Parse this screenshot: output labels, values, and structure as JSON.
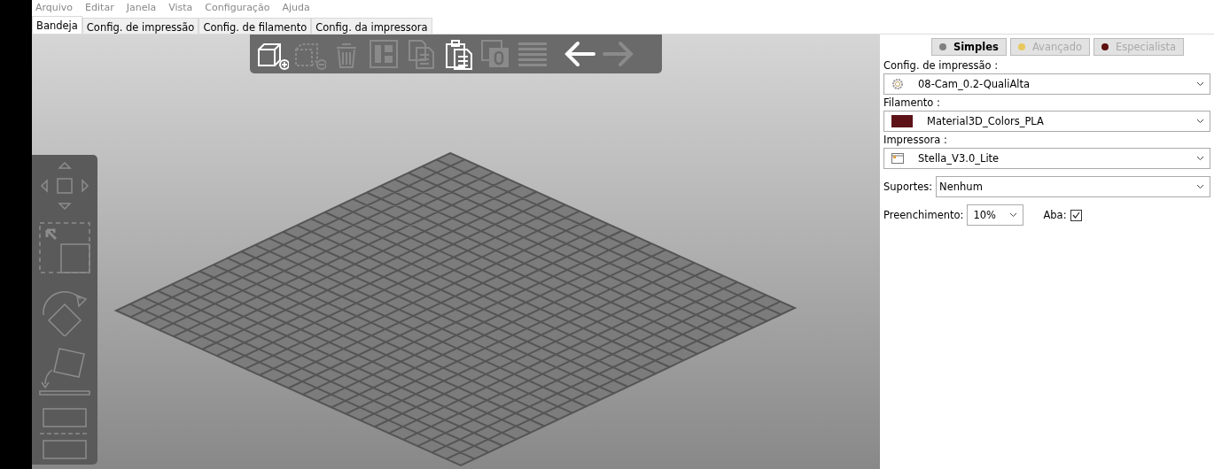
{
  "menu": [
    "Arquivo",
    "Editar",
    "Janela",
    "Vista",
    "Configuração",
    "Ajuda"
  ],
  "tabs": [
    {
      "label": "Bandeja",
      "selected": true
    },
    {
      "label": "Config. de impressão",
      "selected": false
    },
    {
      "label": "Config. de filamento",
      "selected": false
    },
    {
      "label": "Config. da impressora",
      "selected": false
    }
  ],
  "top_toolbar": [
    {
      "kind": "add",
      "disabled": false
    },
    {
      "kind": "remove",
      "disabled": true
    },
    {
      "kind": "delete",
      "disabled": true
    },
    {
      "kind": "arrange",
      "disabled": true
    },
    {
      "kind": "copy",
      "disabled": true
    },
    {
      "kind": "paste",
      "disabled": false
    },
    {
      "kind": "instances",
      "disabled": true
    },
    {
      "kind": "layers",
      "disabled": true
    },
    {
      "kind": "undo",
      "disabled": false
    },
    {
      "kind": "redo",
      "disabled": true
    }
  ],
  "side_toolbar": [
    {
      "kind": "move"
    },
    {
      "kind": "scale"
    },
    {
      "kind": "rotate"
    },
    {
      "kind": "flat"
    },
    {
      "kind": "cut"
    }
  ],
  "modes": [
    {
      "label": "Simples",
      "selected": true,
      "color": "#808080"
    },
    {
      "label": "Avançado",
      "selected": false,
      "color": "#e8c860"
    },
    {
      "label": "Especialista",
      "selected": false,
      "color": "#5c1010"
    }
  ],
  "presets": [
    {
      "label": "Config. de impressão :",
      "kind": "gear",
      "value": "08-Cam_0.2-QualiAlta"
    },
    {
      "label": "Filamento :",
      "kind": "swatch",
      "color": "#5c1216",
      "value": "Material3D_Colors_PLA"
    },
    {
      "label": "Impressora :",
      "kind": "printer",
      "value": "Stella_V3.0_Lite"
    }
  ],
  "supports": {
    "label": "Suportes:",
    "value": "Nenhum"
  },
  "infill": {
    "label": "Preenchimento:",
    "value": "10%"
  },
  "brim": {
    "label": "Aba:",
    "checked": true
  }
}
